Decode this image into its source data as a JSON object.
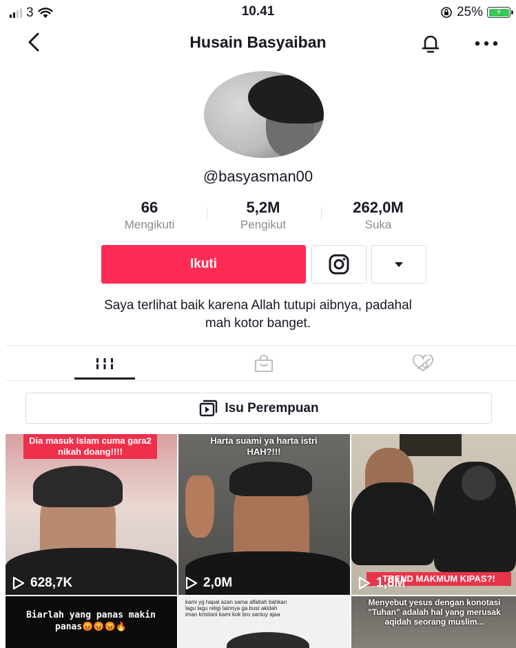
{
  "status_bar": {
    "carrier": "3",
    "time": "10.41",
    "battery": "25%"
  },
  "nav": {
    "title": "Husain Basyaiban"
  },
  "profile": {
    "username": "@basyasman00",
    "stats": [
      {
        "value": "66",
        "label": "Mengikuti"
      },
      {
        "value": "5,2M",
        "label": "Pengikut"
      },
      {
        "value": "262,0M",
        "label": "Suka"
      }
    ],
    "follow_label": "Ikuti",
    "bio_line1": "Saya terlihat baik karena Allah tutupi aibnya, padahal",
    "bio_line2": "mah kotor banget."
  },
  "playlist": {
    "label": "Isu Perempuan"
  },
  "videos": [
    {
      "caption": "Dia masuk Islam cuma gara2 nikah doang!!!!",
      "views": "628,7K"
    },
    {
      "caption": "Harta suami ya harta istri HAH?!!!",
      "views": "2,0M"
    },
    {
      "caption": "TREND MAKMUM KIPAS?!",
      "views": "1,8M"
    },
    {
      "caption": "Biarlah yang panas makin panas😡😡😡🔥",
      "views": ""
    },
    {
      "caption": "kami yg hapal azan sama alfatiah bahkan lagu lagu religi lainnya ga bust akidah iman kristiani kami kok bro santuy ajaa",
      "views": ""
    },
    {
      "caption": "Menyebut yesus dengan konotasi \"Tuhan\" adalah hal yang merusak aqidah seorang muslim...",
      "views": ""
    }
  ],
  "colors": {
    "accent": "#fe2c55",
    "text": "#161823",
    "muted": "#8a8b91"
  },
  "icons": [
    "signal-icon",
    "wifi-icon",
    "orientation-lock-icon",
    "battery-icon",
    "back-icon",
    "bell-icon",
    "more-icon",
    "instagram-icon",
    "caret-down-icon",
    "videos-grid-icon",
    "shop-bag-icon",
    "liked-hidden-icon",
    "playlist-icon",
    "play-icon"
  ]
}
